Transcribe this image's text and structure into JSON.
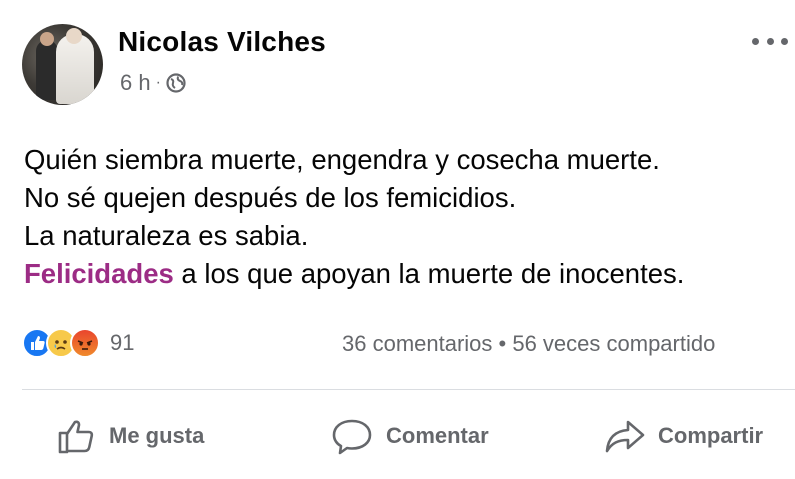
{
  "author": {
    "name": "Nicolas Vilches",
    "time": "6 h",
    "separator": "·",
    "privacy_icon": "globe-icon"
  },
  "post": {
    "lines": [
      "Quién siembra muerte, engendra y cosecha muerte.",
      "No sé quejen después de los femicidios.",
      "La naturaleza es sabia."
    ],
    "last_line_highlight": "Felicidades",
    "last_line_rest": " a los que apoyan la muerte de inocentes."
  },
  "reactions": {
    "icons": [
      "like-icon",
      "sad-icon",
      "angry-icon"
    ],
    "count": "91"
  },
  "stats": {
    "text": "36 comentarios • 56 veces compartido"
  },
  "actions": {
    "like_label": "Me gusta",
    "comment_label": "Comentar",
    "share_label": "Compartir"
  },
  "colors": {
    "highlight": "#9c2c85",
    "like_blue": "#1877f2",
    "secondary_text": "#65676b"
  }
}
